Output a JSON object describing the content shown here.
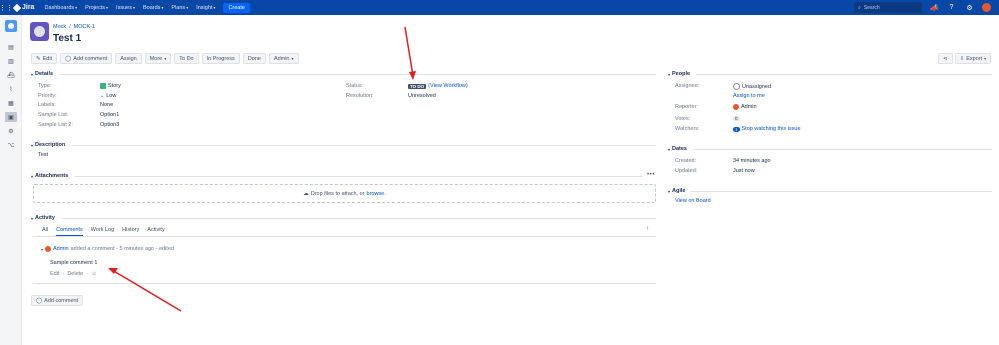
{
  "topnav": {
    "logo": "Jira",
    "items": [
      "Dashboards",
      "Projects",
      "Issues",
      "Boards",
      "Plans",
      "Insight"
    ],
    "create_label": "Create",
    "search_placeholder": "Search"
  },
  "breadcrumb": {
    "project": "Mock",
    "issue_key": "MOCK-1"
  },
  "issue": {
    "title": "Test 1"
  },
  "toolbar": {
    "edit": "Edit",
    "add_comment": "Add comment",
    "assign": "Assign",
    "more": "More",
    "todo": "To Do",
    "in_progress": "In Progress",
    "done": "Done",
    "admin": "Admin",
    "export": "Export"
  },
  "details": {
    "heading": "Details",
    "type_label": "Type:",
    "type_value": "Story",
    "priority_label": "Priority:",
    "priority_value": "Low",
    "labels_label": "Labels:",
    "labels_value": "None",
    "sample_list_label": "Sample List:",
    "sample_list_value": "Option1",
    "sample_list2_label": "Sample List 2:",
    "sample_list2_value": "Option3",
    "status_label": "Status:",
    "status_value": "TO DO",
    "view_workflow": "(View Workflow)",
    "resolution_label": "Resolution:",
    "resolution_value": "Unresolved"
  },
  "description": {
    "heading": "Description",
    "text": "Test"
  },
  "attachments": {
    "heading": "Attachments",
    "drop_text": "Drop files to attach, or",
    "browse": "browse."
  },
  "activity": {
    "heading": "Activity",
    "tabs": [
      "All",
      "Comments",
      "Work Log",
      "History",
      "Activity"
    ],
    "comment": {
      "author": "Admin",
      "meta": "added a comment - 5 minutes ago - edited",
      "body": "Sample comment 1",
      "edit": "Edit",
      "delete": "Delete"
    },
    "add_comment": "Add comment"
  },
  "people": {
    "heading": "People",
    "assignee_label": "Assignee:",
    "assignee_value": "Unassigned",
    "assign_to_me": "Assign to me",
    "reporter_label": "Reporter:",
    "reporter_value": "Admin",
    "votes_label": "Votes:",
    "votes_value": "0",
    "watchers_label": "Watchers:",
    "watchers_count": "1",
    "stop_watching": "Stop watching this issue"
  },
  "dates": {
    "heading": "Dates",
    "created_label": "Created:",
    "created_value": "34 minutes ago",
    "updated_label": "Updated:",
    "updated_value": "Just now"
  },
  "agile": {
    "heading": "Agile",
    "view_on_board": "View on Board"
  },
  "colors": {
    "nav": "#0747a6",
    "link": "#0052cc",
    "annotation_arrow": "#e02020"
  }
}
